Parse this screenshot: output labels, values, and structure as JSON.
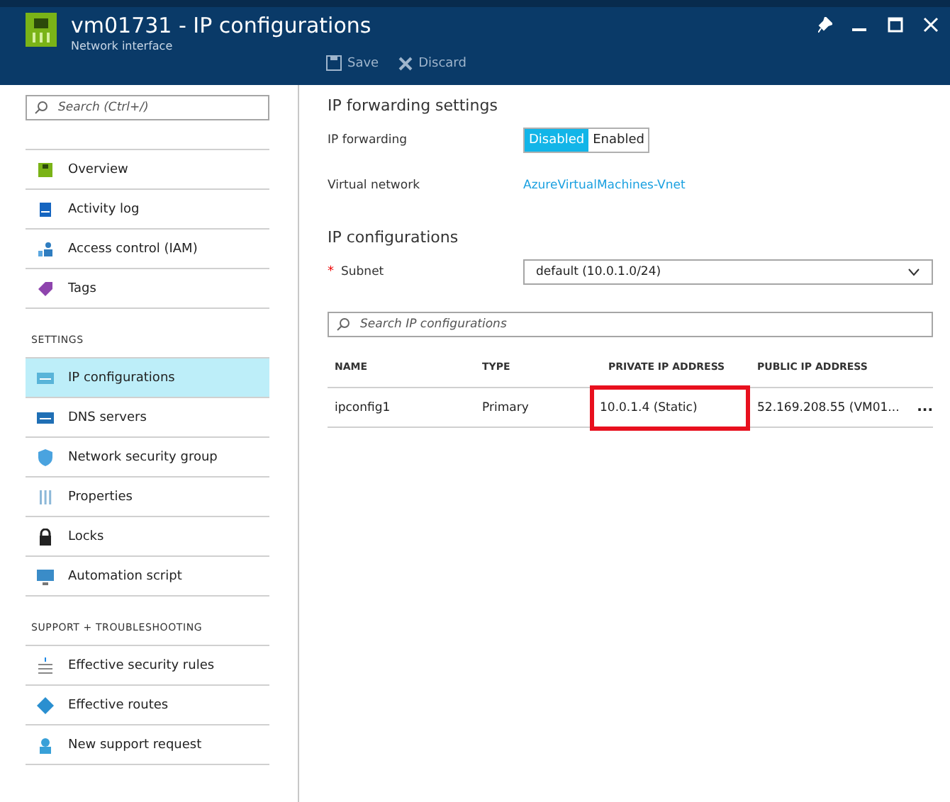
{
  "header": {
    "title": "vm01731 - IP configurations",
    "subtitle": "Network interface",
    "actions": [
      {
        "label": "Save",
        "kind": "save"
      },
      {
        "label": "Discard",
        "kind": "discard"
      }
    ]
  },
  "sidebar": {
    "search": {
      "placeholder": "Search (Ctrl+/)"
    },
    "sections": [
      {
        "items": [
          {
            "label": "Overview",
            "selected": false
          },
          {
            "label": "Activity log",
            "selected": false
          },
          {
            "label": "Access control (IAM)",
            "selected": false
          },
          {
            "label": "Tags",
            "selected": false
          }
        ]
      },
      {
        "heading": "SETTINGS",
        "items": [
          {
            "label": "IP configurations",
            "selected": true
          },
          {
            "label": "DNS servers",
            "selected": false
          },
          {
            "label": "Network security group",
            "selected": false
          },
          {
            "label": "Properties",
            "selected": false
          },
          {
            "label": "Locks",
            "selected": false
          },
          {
            "label": "Automation script",
            "selected": false
          }
        ]
      },
      {
        "heading": "SUPPORT + TROUBLESHOOTING",
        "items": [
          {
            "label": "Effective security rules",
            "selected": false
          },
          {
            "label": "Effective routes",
            "selected": false
          },
          {
            "label": "New support request",
            "selected": false
          }
        ]
      }
    ]
  },
  "forwarding": {
    "heading": "IP forwarding settings",
    "label": "IP forwarding",
    "options": [
      {
        "label": "Disabled",
        "selected": true
      },
      {
        "label": "Enabled",
        "selected": false
      }
    ],
    "vnet_label": "Virtual network",
    "vnet_link": "AzureVirtualMachines-Vnet"
  },
  "configs": {
    "heading": "IP configurations",
    "subnet_label": "Subnet",
    "required_mark": "*",
    "subnet_value": "default (10.0.1.0/24)",
    "search": {
      "placeholder": "Search IP configurations"
    },
    "columns": [
      "NAME",
      "TYPE",
      "PRIVATE IP ADDRESS",
      "PUBLIC IP ADDRESS"
    ],
    "rows": [
      {
        "cells": [
          {
            "text": "ipconfig1",
            "highlighted": false
          },
          {
            "text": "Primary",
            "highlighted": false
          },
          {
            "text": "10.0.1.4 (Static)",
            "highlighted": true
          },
          {
            "text": "52.169.208.55 (VM01...",
            "highlighted": false
          }
        ],
        "more": "..."
      }
    ]
  }
}
